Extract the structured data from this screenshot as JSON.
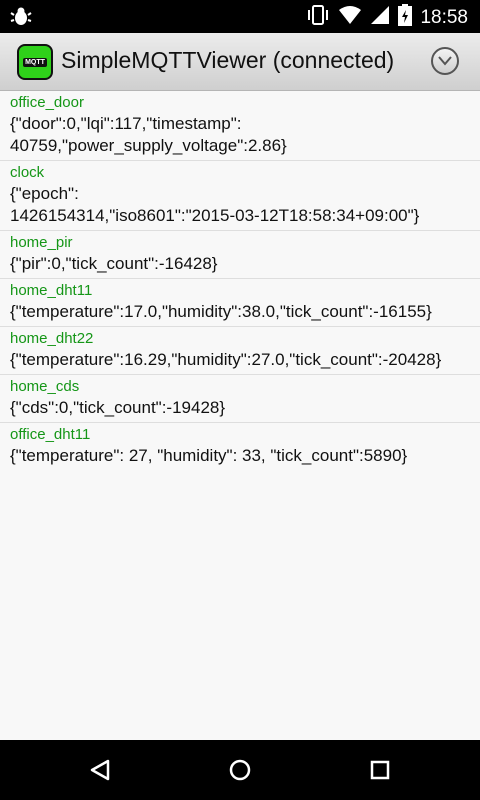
{
  "status_bar": {
    "time": "18:58",
    "icons": [
      "bug-icon",
      "vibrate-icon",
      "wifi-icon",
      "cell-signal-icon",
      "battery-icon"
    ]
  },
  "action_bar": {
    "app_icon_label": "MQTT",
    "title": "SimpleMQTTViewer (connected)",
    "overflow_icon": "chevron-down-icon"
  },
  "messages": [
    {
      "topic": "office_door",
      "payload": "{\"door\":0,\"lqi\":117,\"timestamp\":\n40759,\"power_supply_voltage\":2.86}"
    },
    {
      "topic": "clock",
      "payload": "{\"epoch\":\n1426154314,\"iso8601\":\"2015-03-12T18:58:34+09:00\"}"
    },
    {
      "topic": "home_pir",
      "payload": "{\"pir\":0,\"tick_count\":-16428}"
    },
    {
      "topic": "home_dht11",
      "payload": "{\"temperature\":17.0,\"humidity\":38.0,\"tick_count\":-16155}"
    },
    {
      "topic": "home_dht22",
      "payload": "{\"temperature\":16.29,\"humidity\":27.0,\"tick_count\":-20428}"
    },
    {
      "topic": "home_cds",
      "payload": "{\"cds\":0,\"tick_count\":-19428}"
    },
    {
      "topic": "office_dht11",
      "payload": "{\"temperature\": 27, \"humidity\": 33, \"tick_count\":5890}"
    }
  ],
  "nav_bar": {
    "buttons": [
      "back-icon",
      "home-icon",
      "recents-icon"
    ]
  },
  "colors": {
    "topic": "#159617",
    "accent_app_icon": "#2fd11a"
  }
}
